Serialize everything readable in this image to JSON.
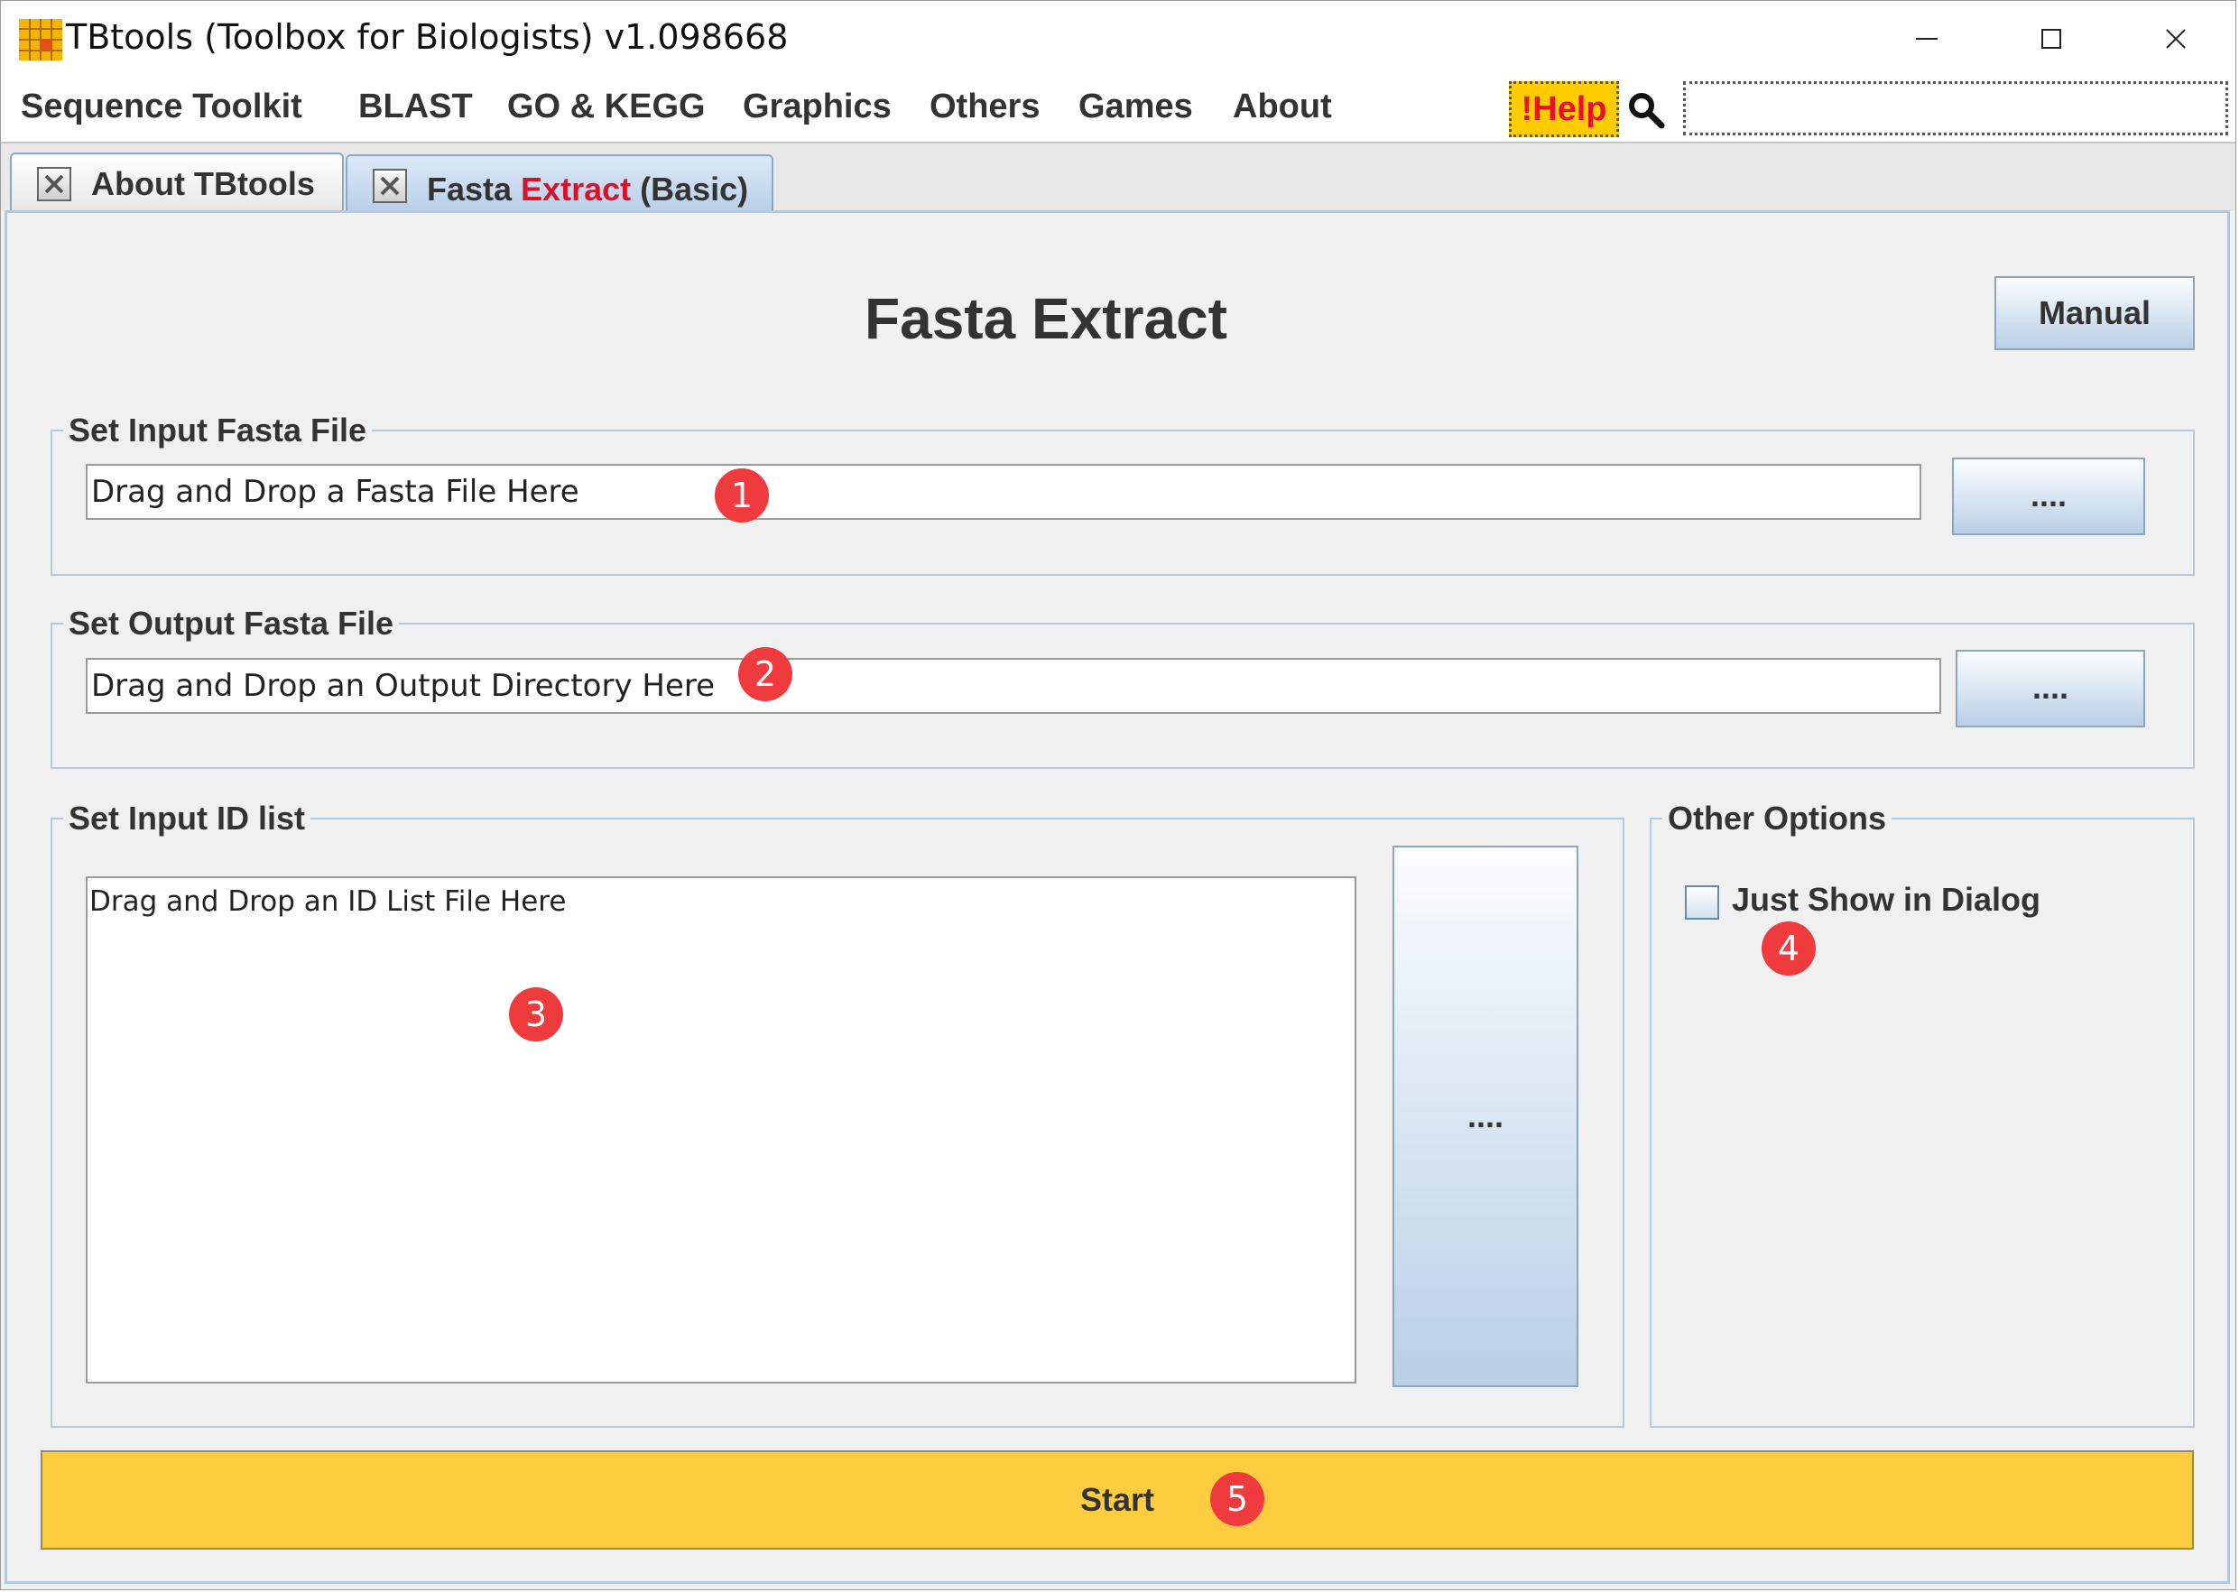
{
  "window": {
    "title": "TBtools (Toolbox for Biologists) v1.098668"
  },
  "menu": {
    "items": [
      "Sequence Toolkit",
      "BLAST",
      "GO & KEGG",
      "Graphics",
      "Others",
      "Games",
      "About"
    ],
    "help_label": "!Help",
    "search_value": ""
  },
  "tabs": {
    "about": "About TBtools",
    "fasta_prefix": "Fasta ",
    "fasta_highlight": "Extract",
    "fasta_suffix": " (Basic)"
  },
  "main": {
    "title": "Fasta Extract",
    "manual_label": "Manual",
    "input_fasta": {
      "legend": "Set Input Fasta File",
      "value": "Drag and Drop a Fasta File Here",
      "browse_label": "...."
    },
    "output_fasta": {
      "legend": "Set Output Fasta File",
      "value": "Drag and Drop an Output Directory Here",
      "browse_label": "...."
    },
    "id_list": {
      "legend": "Set Input ID list",
      "value": "Drag and Drop an ID List File Here",
      "browse_label": "...."
    },
    "other_options": {
      "legend": "Other Options",
      "just_show_label": "Just Show in Dialog",
      "just_show_checked": false
    },
    "start_label": "Start"
  },
  "markers": [
    "1",
    "2",
    "3",
    "4",
    "5"
  ],
  "colors": {
    "help_bg": "#ffcc00",
    "help_text": "#e8102a",
    "start_bg": "#fecd3f",
    "marker": "#ef3a3e",
    "tab_highlight": "#d8122a"
  }
}
